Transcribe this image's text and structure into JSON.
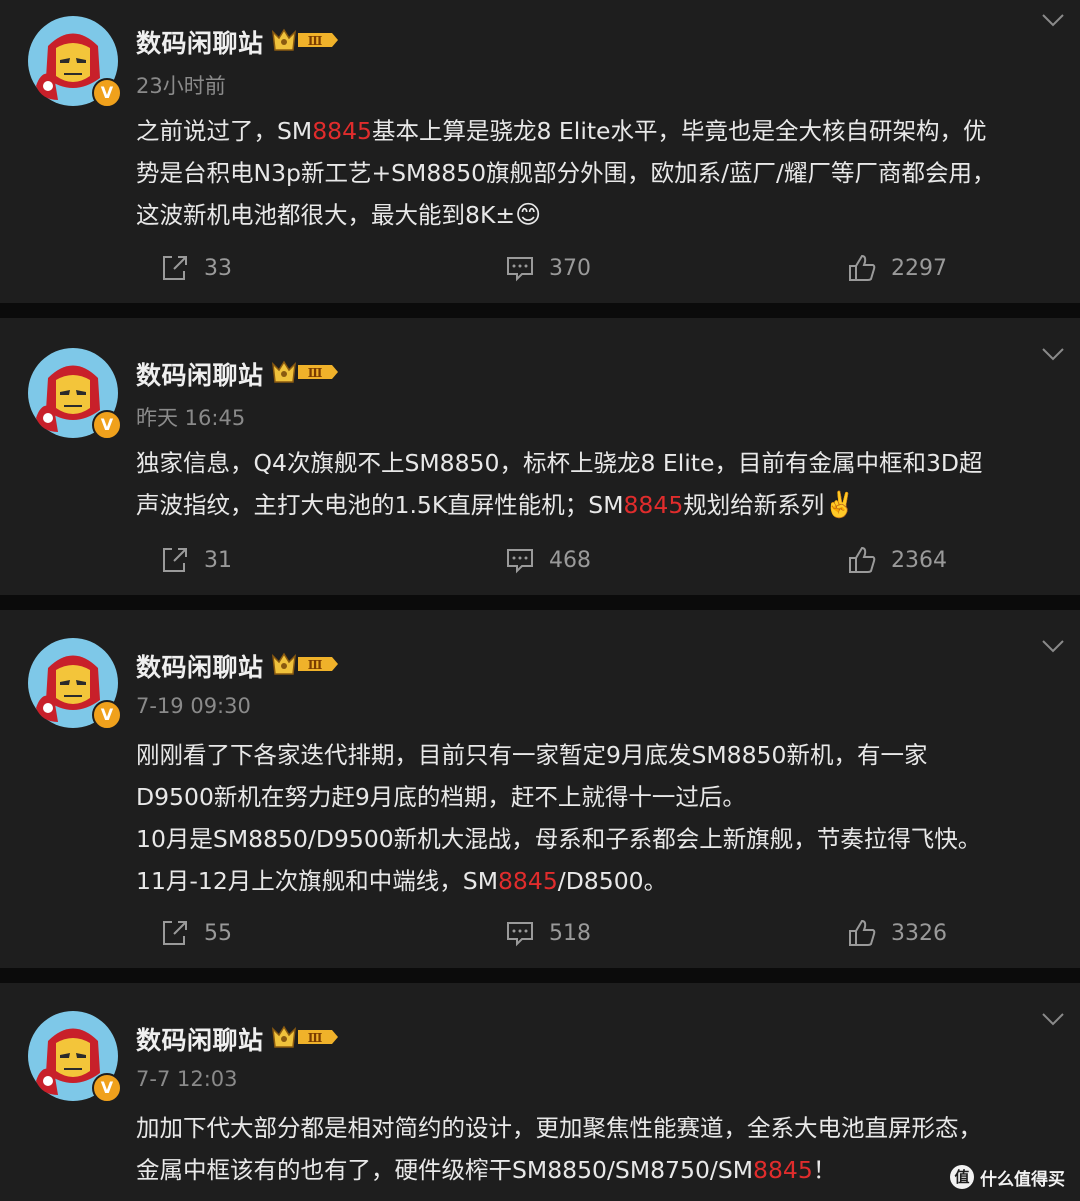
{
  "posts": [
    {
      "author": "数码闲聊站",
      "level": "Ⅲ",
      "time": "23小时前",
      "text_parts": [
        "之前说过了，SM",
        "8845",
        "基本上算是骁龙8 Elite水平，毕竟也是全大核自研架构，优\n势是台积电N3p新工艺+SM8850旗舰部分外围，欧加系/蓝厂/耀厂等厂商都会用，\n这波新机电池都很大，最大能到8K±",
        "😊",
        ""
      ],
      "share": "33",
      "comments": "370",
      "likes": "2297"
    },
    {
      "author": "数码闲聊站",
      "level": "Ⅲ",
      "time": "昨天 16:45",
      "text_parts": [
        "独家信息，Q4次旗舰不上SM8850，标杯上骁龙8 Elite，目前有金属中框和3D超\n声波指纹，主打大电池的1.5K直屏性能机；SM",
        "8845",
        "规划给新系列",
        "✌️",
        ""
      ],
      "share": "31",
      "comments": "468",
      "likes": "2364"
    },
    {
      "author": "数码闲聊站",
      "level": "Ⅲ",
      "time": "7-19 09:30",
      "text_parts": [
        "刚刚看了下各家迭代排期，目前只有一家暂定9月底发SM8850新机，有一家\nD9500新机在努力赶9月底的档期，赶不上就得十一过后。\n10月是SM8850/D9500新机大混战，母系和子系都会上新旗舰，节奏拉得飞快。\n11月-12月上次旗舰和中端线，SM",
        "8845",
        "/D8500。",
        "",
        ""
      ],
      "share": "55",
      "comments": "518",
      "likes": "3326"
    },
    {
      "author": "数码闲聊站",
      "level": "Ⅲ",
      "time": "7-7 12:03",
      "text_parts": [
        "加加下代大部分都是相对简约的设计，更加聚焦性能赛道，全系大电池直屏形态，\n金属中框该有的也有了，硬件级榨干SM8850/SM8750/SM",
        "8845",
        "！",
        "",
        ""
      ]
    }
  ],
  "verified_badge": "V",
  "watermark": {
    "logo": "值",
    "text": "什么值得买"
  },
  "colors": {
    "highlight": "#e02c2c",
    "card": "#1e1e1e",
    "background": "#0b0b0b",
    "badge": "#f0a11c"
  }
}
